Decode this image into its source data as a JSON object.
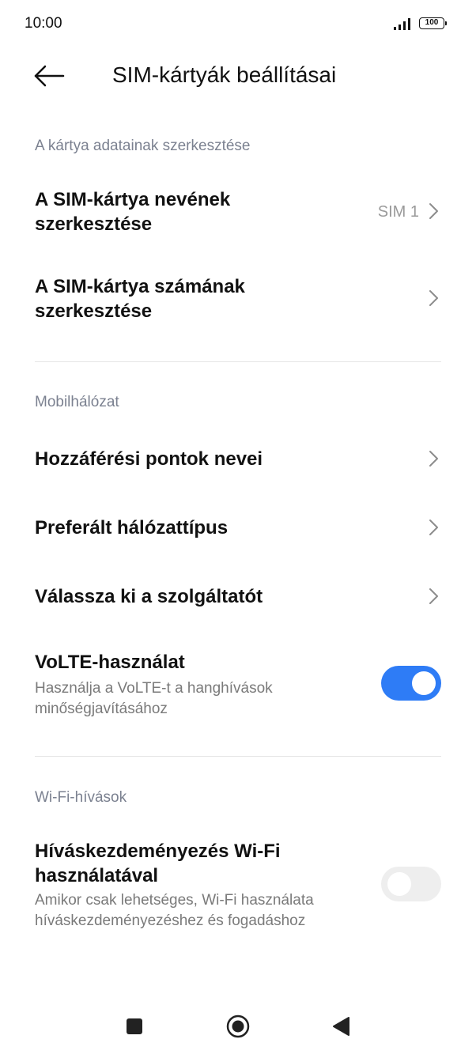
{
  "status_bar": {
    "time": "10:00",
    "battery": "100"
  },
  "header": {
    "title": "SIM-kártyák beállításai",
    "back_icon": "arrow-left-icon"
  },
  "sections": {
    "card_data": {
      "header": "A kártya adatainak szerkesztése",
      "edit_name": {
        "title_line1": "A SIM-kártya nevének",
        "title_line2": "szerkesztése",
        "value": "SIM 1"
      },
      "edit_number": {
        "title_line1": "A SIM-kártya számának",
        "title_line2": "szerkesztése"
      }
    },
    "mobile_network": {
      "header": "Mobilhálózat",
      "apn": "Hozzáférési pontok nevei",
      "preferred_network": "Preferált hálózattípus",
      "choose_operator": "Válassza ki a szolgáltatót",
      "volte": {
        "title": "VoLTE-használat",
        "subtitle_line1": "Használja a VoLTE-t a hanghívások",
        "subtitle_line2": "minőségjavításához",
        "enabled": true
      }
    },
    "wifi_calls": {
      "header": "Wi-Fi-hívások",
      "wifi_calling": {
        "title_line1": "Híváskezdeményezés Wi-Fi",
        "title_line2": "használatával",
        "subtitle_line1": "Amikor csak lehetséges, Wi-Fi használata",
        "subtitle_line2": "híváskezdeményezéshez és fogadáshoz",
        "enabled": false
      }
    }
  },
  "nav_bar": {
    "recents_icon": "square-icon",
    "home_icon": "circle-icon",
    "back_icon": "triangle-back-icon"
  },
  "colors": {
    "accent": "#2e7cf6",
    "section_header": "#7b8190",
    "subtitle": "#7a7a7a",
    "divider": "#e6e6e6"
  }
}
